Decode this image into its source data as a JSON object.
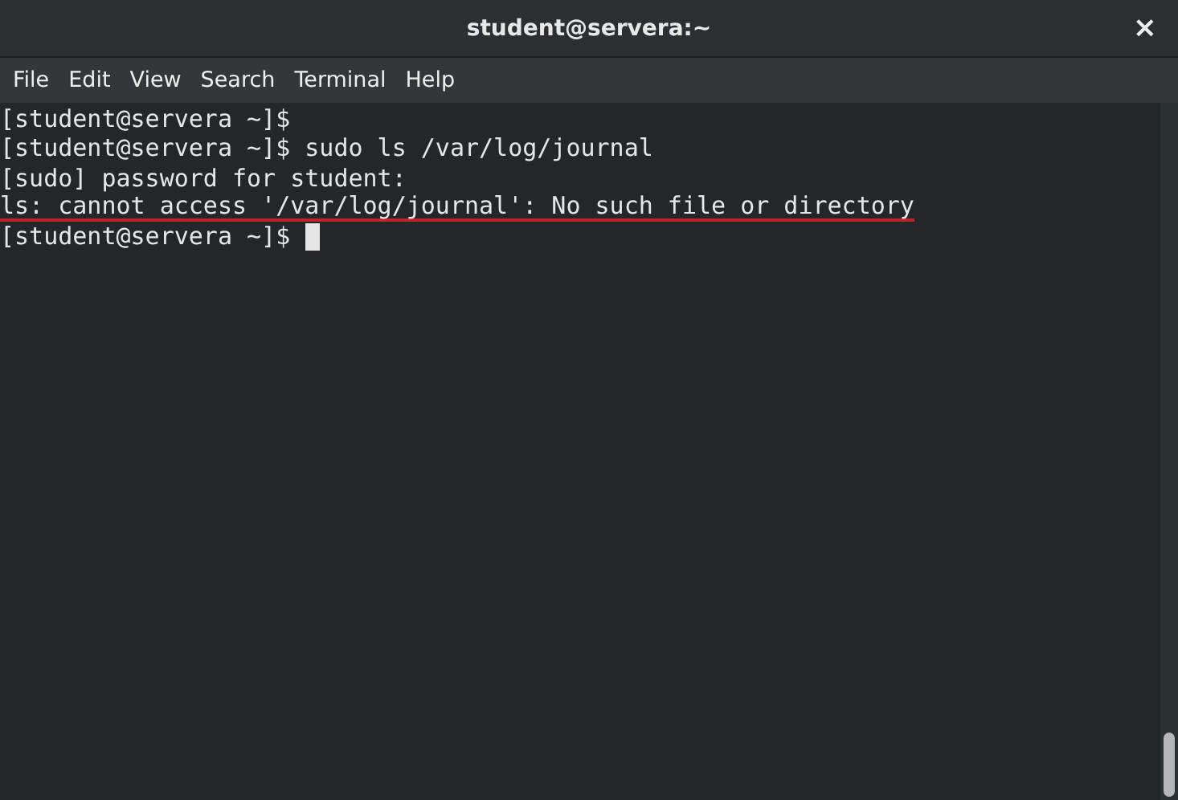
{
  "window": {
    "title": "student@servera:~",
    "close": "×"
  },
  "menu": [
    "File",
    "Edit",
    "View",
    "Search",
    "Terminal",
    "Help"
  ],
  "terminal": {
    "lines": [
      {
        "text": "[student@servera ~]$",
        "underlined": false,
        "cursor": false
      },
      {
        "text": "[student@servera ~]$ sudo ls /var/log/journal",
        "underlined": false,
        "cursor": false
      },
      {
        "text": "[sudo] password for student:",
        "underlined": false,
        "cursor": false
      },
      {
        "text": "ls: cannot access '/var/log/journal': No such file or directory",
        "underlined": true,
        "cursor": false
      },
      {
        "text": "[student@servera ~]$ ",
        "underlined": false,
        "cursor": true
      }
    ]
  }
}
